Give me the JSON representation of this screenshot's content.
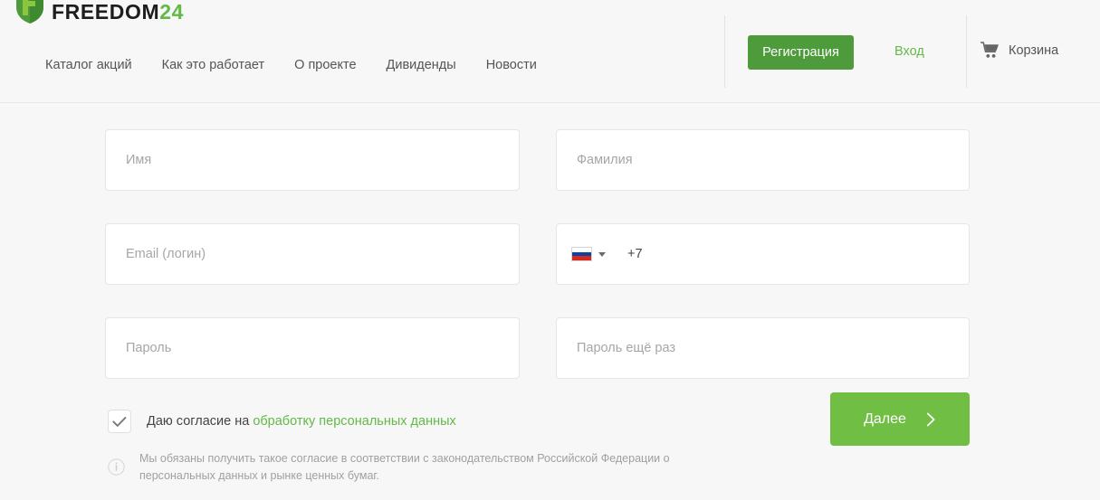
{
  "brand": {
    "name_main": "FREEDOM",
    "name_suffix": "24",
    "shield_icon": "shield-logo-icon",
    "green": "#63b947",
    "dark": "#1d1d1b"
  },
  "header": {
    "nav": [
      {
        "label": "Каталог акций",
        "name": "nav-catalog"
      },
      {
        "label": "Как это работает",
        "name": "nav-how-it-works"
      },
      {
        "label": "О проекте",
        "name": "nav-about"
      },
      {
        "label": "Дивиденды",
        "name": "nav-dividends"
      },
      {
        "label": "Новости",
        "name": "nav-news"
      }
    ],
    "register_label": "Регистрация",
    "login_label": "Вход",
    "cart_label": "Корзина",
    "cart_icon": "shopping-cart-icon",
    "register_color": "#4d9b3b"
  },
  "form": {
    "fields": {
      "first_name": {
        "placeholder": "Имя",
        "value": ""
      },
      "last_name": {
        "placeholder": "Фамилия",
        "value": ""
      },
      "email": {
        "placeholder": "Email (логин)",
        "value": ""
      },
      "password": {
        "placeholder": "Пароль",
        "value": ""
      },
      "password_confirm": {
        "placeholder": "Пароль ещё раз",
        "value": ""
      }
    },
    "phone": {
      "country_flag": "russia-flag-icon",
      "country_code": "+7",
      "placeholder": "",
      "value": "",
      "dropdown_icon": "chevron-down-icon"
    },
    "consent": {
      "checked": true,
      "check_icon": "checkmark-icon",
      "text_before": "Даю согласие на ",
      "link_label": "обработку персональных данных"
    },
    "disclaimer": {
      "info_icon": "info-circle-icon",
      "text": "Мы обязаны получить такое согласие в соответствии с законодательством Российской Федерации о персональных данных и рынке ценных бумаг."
    },
    "submit": {
      "label": "Далее",
      "arrow_icon": "chevron-right-icon",
      "color": "#70bf44"
    }
  }
}
